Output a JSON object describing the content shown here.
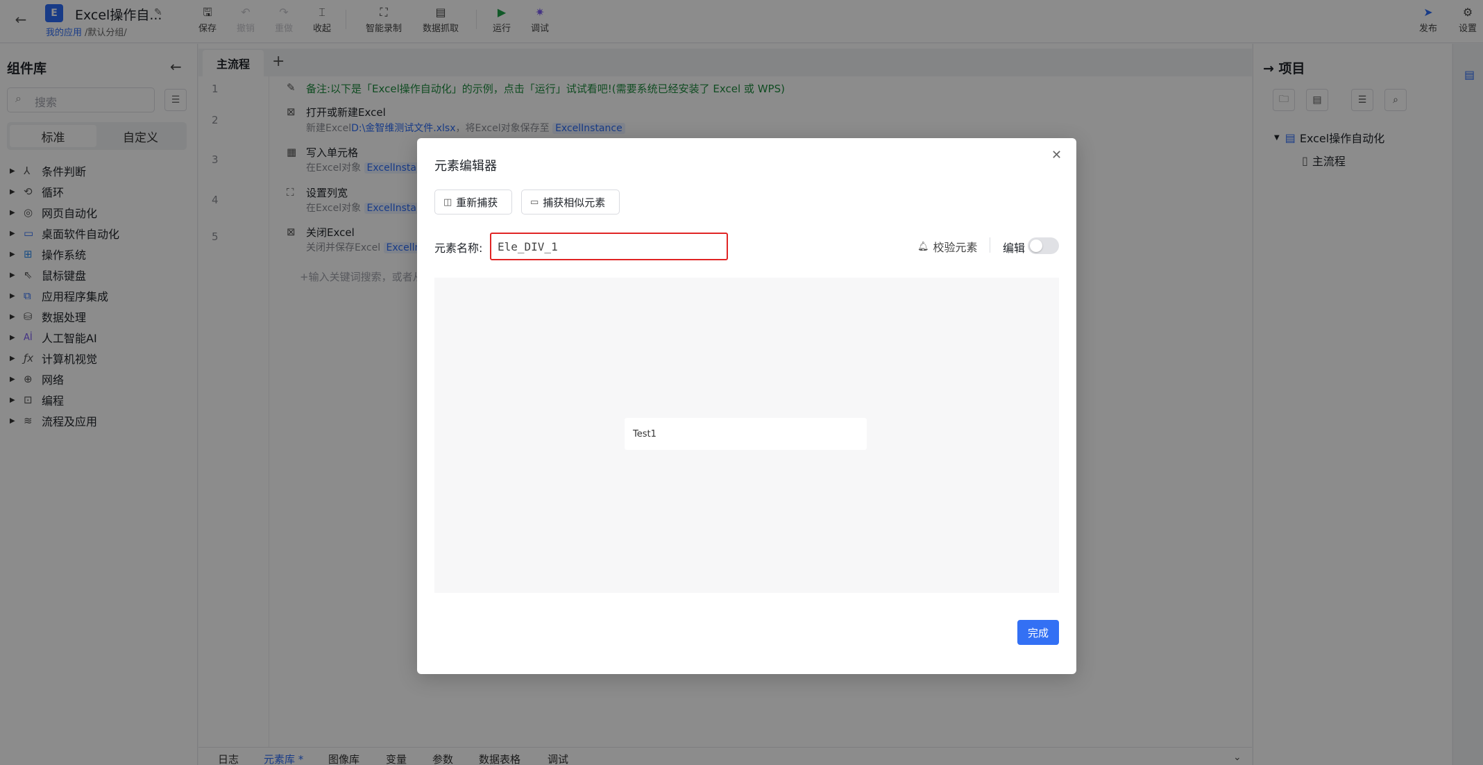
{
  "app": {
    "logo_letter": "E",
    "title": "Excel操作自...",
    "breadcrumb_link": "我的应用",
    "breadcrumb_rest": "/默认分组/"
  },
  "toolbar": {
    "save": "保存",
    "undo": "撤销",
    "redo": "重做",
    "collapse": "收起",
    "smart_record": "智能录制",
    "data_capture": "数据抓取",
    "run": "运行",
    "debug": "调试",
    "publish": "发布",
    "settings": "设置"
  },
  "library": {
    "title": "组件库",
    "search_placeholder": "搜索",
    "tab_standard": "标准",
    "tab_custom": "自定义",
    "categories": [
      {
        "label": "条件判断",
        "icon": "branch-icon"
      },
      {
        "label": "循环",
        "icon": "loop-icon"
      },
      {
        "label": "网页自动化",
        "icon": "browser-icon"
      },
      {
        "label": "桌面软件自动化",
        "icon": "desktop-icon"
      },
      {
        "label": "操作系统",
        "icon": "windows-icon"
      },
      {
        "label": "鼠标键盘",
        "icon": "cursor-icon"
      },
      {
        "label": "应用程序集成",
        "icon": "app-integration-icon"
      },
      {
        "label": "数据处理",
        "icon": "database-icon"
      },
      {
        "label": "人工智能AI",
        "icon": "ai-icon"
      },
      {
        "label": "计算机视觉",
        "icon": "fx-icon"
      },
      {
        "label": "网络",
        "icon": "globe-icon"
      },
      {
        "label": "编程",
        "icon": "code-icon"
      },
      {
        "label": "流程及应用",
        "icon": "layers-icon"
      }
    ]
  },
  "editor": {
    "tab_main": "主流程",
    "tab_add": "+",
    "line_numbers": [
      "1",
      "2",
      "3",
      "4",
      "5"
    ],
    "note": "备注:以下是「Excel操作自动化」的示例，点击「运行」试试看吧!(需要系统已经安装了 Excel 或 WPS)",
    "steps": [
      {
        "title": "打开或新建Excel",
        "desc_prefix": "新建Excel",
        "desc_path": "D:\\金智维测试文件.xlsx",
        "desc_mid": "，将Excel对象保存至 ",
        "desc_var": "ExcelInstance"
      },
      {
        "title": "写入单元格",
        "desc_prefix": "在Excel对象 ",
        "desc_var": "ExcelInstan"
      },
      {
        "title": "设置列宽",
        "desc_prefix": "在Excel对象 ",
        "desc_var": "ExcelInstan"
      },
      {
        "title": "关闭Excel",
        "desc_prefix": "关闭并保存Excel ",
        "desc_var": "Excelln"
      }
    ],
    "add_hint": "+输入关键词搜索，或者从"
  },
  "bottom_tabs": [
    "日志",
    "元素库 *",
    "图像库",
    "变量",
    "参数",
    "数据表格",
    "调试"
  ],
  "project": {
    "title": "项目",
    "tree_root": "Excel操作自动化",
    "tree_child": "主流程"
  },
  "modal": {
    "title": "元素编辑器",
    "recapture": "重新捕获",
    "capture_similar": "捕获相似元素",
    "name_label": "元素名称:",
    "name_value": "Ele_DIV_1",
    "verify": "校验元素",
    "edit": "编辑",
    "edit_on": false,
    "preview_text": "Test1",
    "done": "完成"
  },
  "colors": {
    "accent": "#3370f4",
    "note_green": "#1e8a3e",
    "highlight_border": "#e02424"
  }
}
